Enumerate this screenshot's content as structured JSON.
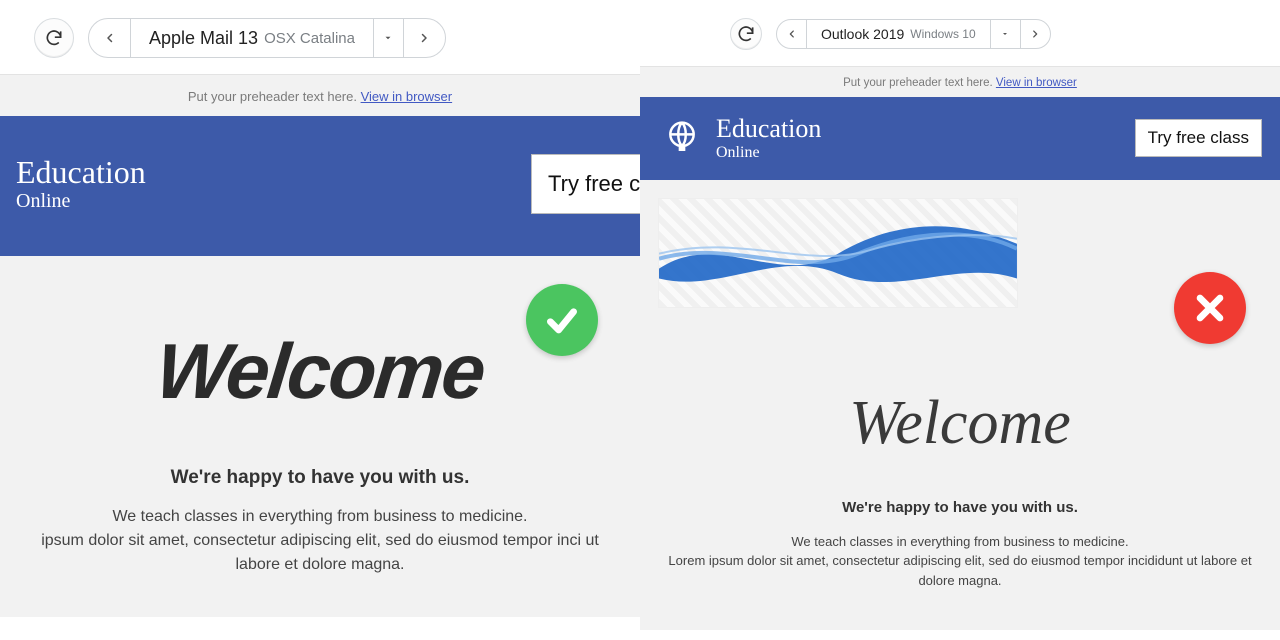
{
  "left": {
    "client": "Apple Mail 13",
    "os": "OSX Catalina",
    "preheader_text": "Put your preheader text here. ",
    "preheader_link": "View in browser",
    "brand_line1": "Education",
    "brand_line2": "Online",
    "cta": "Try free cl",
    "welcome": "Welcome",
    "subhead": "We're happy to have you with us.",
    "para1": "We teach classes in everything from business to medicine.",
    "para2": "ipsum dolor sit amet, consectetur adipiscing elit, sed do eiusmod tempor inci ut labore et dolore magna.",
    "status": "good"
  },
  "right": {
    "client": "Outlook 2019",
    "os": "Windows 10",
    "preheader_text": "Put your preheader text here. ",
    "preheader_link": "View in browser",
    "brand_line1": "Education",
    "brand_line2": "Online",
    "cta": "Try free class",
    "welcome": "Welcome",
    "subhead": "We're happy to have you with us.",
    "para1": "We teach classes in everything from business to medicine.",
    "para2": "Lorem ipsum dolor sit amet, consectetur adipiscing elit, sed do eiusmod tempor incididunt ut labore et dolore magna.",
    "status": "bad"
  }
}
